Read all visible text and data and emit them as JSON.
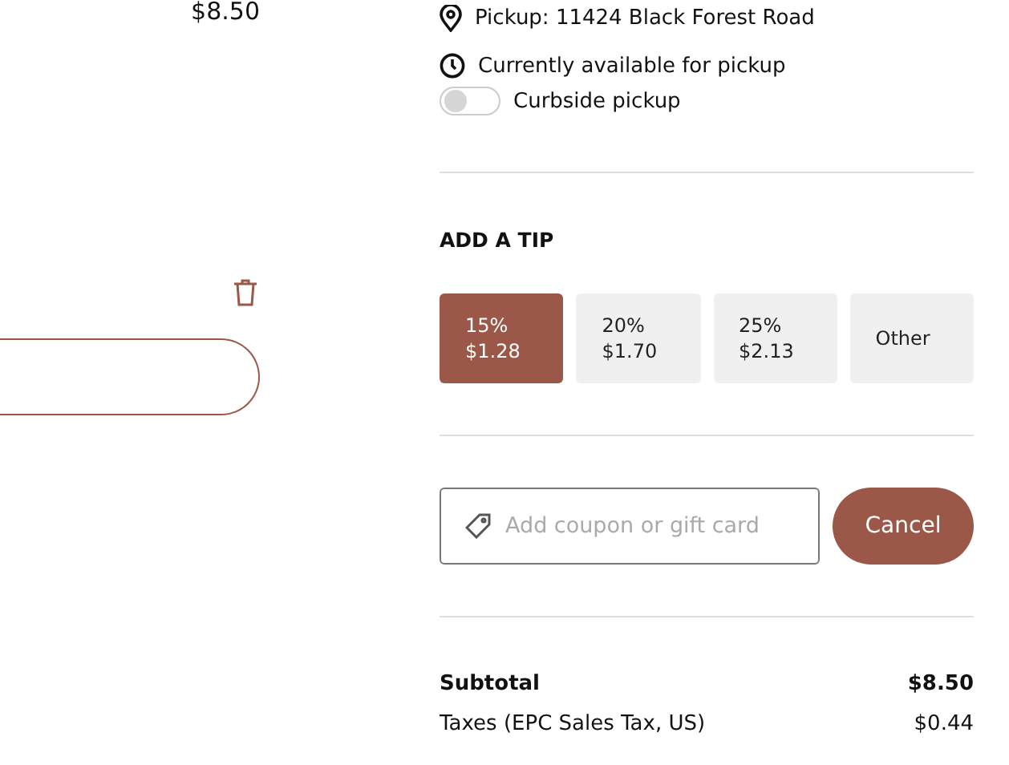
{
  "item": {
    "price": "$8.50"
  },
  "pickup": {
    "address": "Pickup: 11424 Black Forest Road",
    "availability": "Currently available for pickup",
    "curbside": {
      "label": "Curbside pickup",
      "on": false
    }
  },
  "tip": {
    "heading": "ADD A TIP",
    "options": [
      {
        "percent": "15%",
        "amount": "$1.28",
        "selected": true
      },
      {
        "percent": "20%",
        "amount": "$1.70",
        "selected": false
      },
      {
        "percent": "25%",
        "amount": "$2.13",
        "selected": false
      },
      {
        "label": "Other",
        "selected": false
      }
    ]
  },
  "coupon": {
    "placeholder": "Add coupon or gift card",
    "button": "Cancel"
  },
  "summary": [
    {
      "label": "Subtotal",
      "value": "$8.50",
      "kind": "bold"
    },
    {
      "label": "Taxes (EPC Sales Tax, US)",
      "value": "$0.44",
      "kind": "plain"
    }
  ]
}
